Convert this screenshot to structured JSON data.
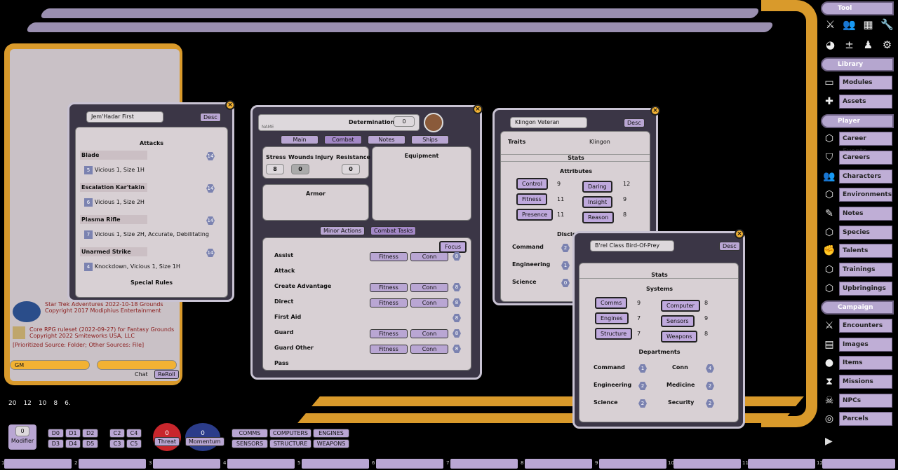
{
  "colors": {
    "lcars_purple": "#9a8fb0",
    "lcars_gold": "#d99a2b",
    "panel_bg": "#d8d0d4",
    "button": "#b9a6d3"
  },
  "chat": {
    "lines": [
      {
        "text": "Star Trek Adventures 2022-10-18 Grounds",
        "sub": "Copyright 2017 Modiphius Entertainment"
      },
      {
        "text": "Core RPG ruleset (2022-09-27) for Fantasy Grounds",
        "sub": "Copyright 2022 Smiteworks USA, LLC"
      }
    ],
    "source_line": "[Prioritized Source: Folder; Other Sources: File]",
    "identity": "GM",
    "chat_label": "Chat",
    "reroll_label": "ReRoll"
  },
  "jemhadar": {
    "name": "Jem'Hadar First",
    "desc_label": "Desc",
    "attacks_header": "Attacks",
    "attacks": [
      {
        "name": "Blade",
        "dmg": "5",
        "desc": "Vicious 1, Size 1H",
        "hex": "14"
      },
      {
        "name": "Escalation Kar'takin",
        "dmg": "6",
        "desc": "Vicious 1, Size 2H",
        "hex": "14"
      },
      {
        "name": "Plasma Rifle",
        "dmg": "7",
        "desc": "Vicious 1, Size 2H, Accurate, Debilitating",
        "hex": "14"
      },
      {
        "name": "Unarmed Strike",
        "dmg": "4",
        "desc": "Knockdown, Vicious 1, Size 1H",
        "hex": "14"
      }
    ],
    "special_rules": "Special Rules"
  },
  "pc": {
    "name_placeholder": "NAME",
    "determination_label": "Determination",
    "determination_value": "0",
    "tabs": [
      "Main",
      "Combat",
      "Notes",
      "Ships"
    ],
    "stress_label": "Stress",
    "stress_value": "8",
    "wounds_label": "Wounds",
    "wounds_value": "0",
    "injury_label": "Injury",
    "resistance_label": "Resistance",
    "resistance_value": "0",
    "equipment_label": "Equipment",
    "armor_label": "Armor",
    "minor_actions": "Minor Actions",
    "combat_tasks": "Combat Tasks",
    "focus_label": "Focus",
    "tasks": [
      {
        "name": "Assist",
        "a": "Fitness",
        "b": "Conn",
        "n": "8"
      },
      {
        "name": "Attack",
        "a": "",
        "b": "",
        "n": ""
      },
      {
        "name": "Create Advantage",
        "a": "Fitness",
        "b": "Conn",
        "n": "8"
      },
      {
        "name": "Direct",
        "a": "Fitness",
        "b": "Conn",
        "n": "8"
      },
      {
        "name": "First Aid",
        "a": "",
        "b": "",
        "n": "8"
      },
      {
        "name": "Guard",
        "a": "Fitness",
        "b": "Conn",
        "n": "8"
      },
      {
        "name": "Guard Other",
        "a": "Fitness",
        "b": "Conn",
        "n": "8"
      },
      {
        "name": "Pass",
        "a": "",
        "b": "",
        "n": ""
      }
    ]
  },
  "klingon": {
    "name": "Klingon Veteran",
    "desc_label": "Desc",
    "traits_label": "Traits",
    "traits_value": "Klingon",
    "stats_header": "Stats",
    "attributes_header": "Attributes",
    "attributes": [
      {
        "a": "Control",
        "av": "9",
        "b": "Daring",
        "bv": "12"
      },
      {
        "a": "Fitness",
        "av": "11",
        "b": "Insight",
        "bv": "9"
      },
      {
        "a": "Presence",
        "av": "11",
        "b": "Reason",
        "bv": "8"
      }
    ],
    "disciplines_header": "Disciplines",
    "disciplines": [
      {
        "name": "Command",
        "v": "2"
      },
      {
        "name": "Engineering",
        "v": "1"
      },
      {
        "name": "Science",
        "v": "0"
      }
    ]
  },
  "ship": {
    "name": "B'rel Class Bird-Of-Prey",
    "desc_label": "Desc",
    "stats_header": "Stats",
    "systems_header": "Systems",
    "systems": [
      {
        "a": "Comms",
        "av": "9",
        "b": "Computer",
        "bv": "8"
      },
      {
        "a": "Engines",
        "av": "7",
        "b": "Sensors",
        "bv": "9"
      },
      {
        "a": "Structure",
        "av": "7",
        "b": "Weapons",
        "bv": "8"
      }
    ],
    "departments_header": "Departments",
    "departments": [
      {
        "a": "Command",
        "av": "1",
        "b": "Conn",
        "bv": "4"
      },
      {
        "a": "Engineering",
        "av": "2",
        "b": "Medicine",
        "bv": "2"
      },
      {
        "a": "Science",
        "av": "2",
        "b": "Security",
        "bv": "2"
      }
    ]
  },
  "sidebar": {
    "tool_label": "Tool",
    "library_label": "Library",
    "library": [
      "Modules",
      "Assets"
    ],
    "player_label": "Player",
    "player": [
      "Career Events",
      "Careers",
      "Characters",
      "Environments",
      "Notes",
      "Species",
      "Talents",
      "Trainings",
      "Upbringings"
    ],
    "campaign_label": "Campaign",
    "campaign": [
      "Encounters",
      "Images",
      "Items",
      "Missions",
      "NPCs",
      "Parcels"
    ]
  },
  "dice": [
    "20",
    "12",
    "10",
    "8",
    "6."
  ],
  "bottom": {
    "modifier_value": "0",
    "modifier_label": "Modifier",
    "d_buttons": [
      "D0",
      "D1",
      "D2",
      "D3",
      "D4",
      "D5"
    ],
    "c_buttons": [
      "C2",
      "C4",
      "C3",
      "C5"
    ],
    "threat_value": "0",
    "threat_label": "Threat",
    "momentum_value": "0",
    "momentum_label": "Momentum",
    "systems": [
      "COMMS",
      "COMPUTERS",
      "ENGINES",
      "SENSORS",
      "STRUCTURE",
      "WEAPONS"
    ],
    "hotkey_numbers": [
      "1",
      "2",
      "3",
      "4",
      "5",
      "6",
      "7",
      "8",
      "9",
      "10",
      "11",
      "12"
    ]
  }
}
